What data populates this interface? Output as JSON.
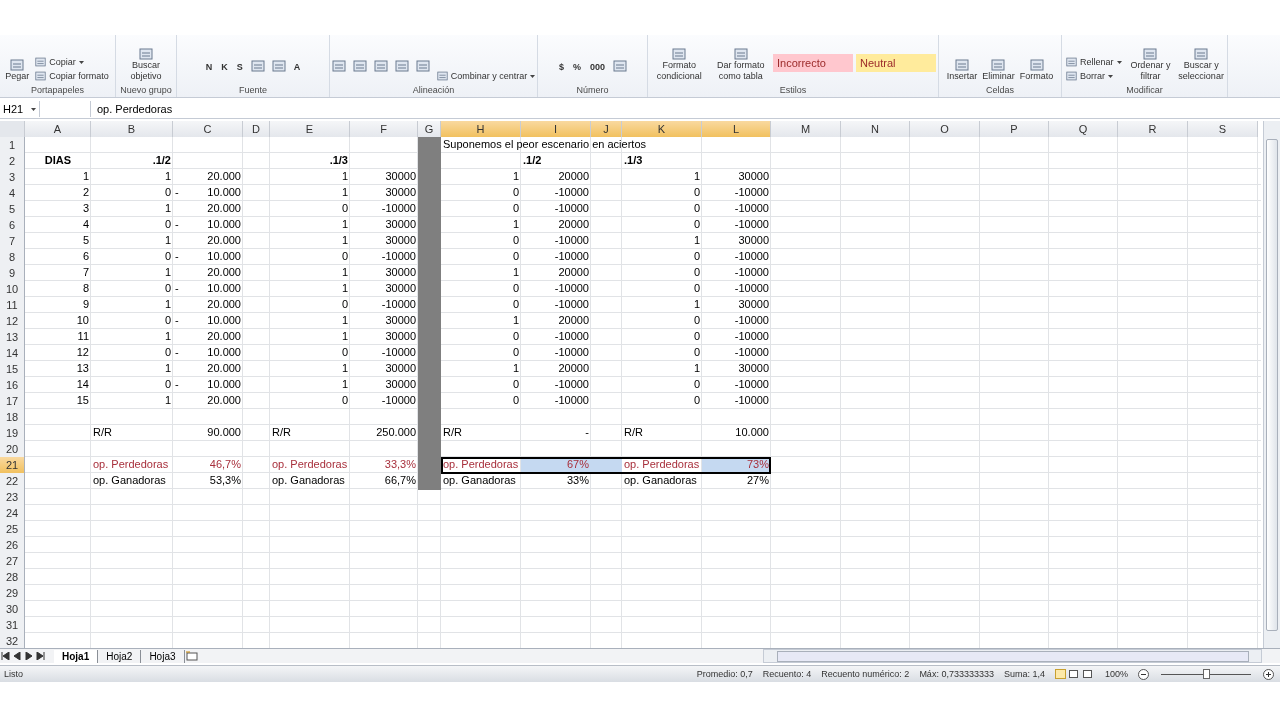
{
  "ribbon": {
    "groups": [
      {
        "label": "Portapapeles",
        "columns": [
          [
            {
              "kind": "big",
              "label": "Pegar"
            }
          ],
          [
            {
              "kind": "small",
              "label": "Copiar",
              "caret": true
            },
            {
              "kind": "small",
              "label": "Copiar formato",
              "caret": false
            }
          ]
        ]
      },
      {
        "label": "Nuevo grupo",
        "columns": [
          [
            {
              "kind": "big",
              "label": "Buscar objetivo"
            }
          ]
        ]
      },
      {
        "label": "Fuente",
        "columns": [
          [
            {
              "kind": "glyph",
              "label": "N"
            }
          ],
          [
            {
              "kind": "glyph",
              "label": "K"
            }
          ],
          [
            {
              "kind": "glyph",
              "label": "S"
            }
          ],
          [
            {
              "kind": "icon"
            }
          ],
          [
            {
              "kind": "icon"
            }
          ],
          [
            {
              "kind": "glyph",
              "label": "A"
            }
          ]
        ]
      },
      {
        "label": "Alineación",
        "columns": [
          [
            {
              "kind": "icon"
            }
          ],
          [
            {
              "kind": "icon"
            }
          ],
          [
            {
              "kind": "icon"
            }
          ],
          [
            {
              "kind": "icon"
            }
          ],
          [
            {
              "kind": "icon"
            }
          ],
          [
            {
              "kind": "small",
              "label": "Combinar y centrar",
              "caret": true
            }
          ]
        ]
      },
      {
        "label": "Número",
        "columns": [
          [
            {
              "kind": "glyph",
              "label": "$"
            }
          ],
          [
            {
              "kind": "glyph",
              "label": "%"
            }
          ],
          [
            {
              "kind": "glyph",
              "label": "000"
            }
          ],
          [
            {
              "kind": "icon"
            }
          ]
        ]
      },
      {
        "label": "Estilos",
        "columns": [
          [
            {
              "kind": "big",
              "label": "Formato condicional"
            }
          ],
          [
            {
              "kind": "big",
              "label": "Dar formato como tabla"
            }
          ],
          [
            {
              "kind": "style",
              "label": "Incorrecto",
              "color": "#ffc7ce"
            }
          ],
          [
            {
              "kind": "style",
              "label": "Neutral",
              "color": "#ffeb9c"
            }
          ]
        ]
      },
      {
        "label": "Celdas",
        "columns": [
          [
            {
              "kind": "big",
              "label": "Insertar"
            }
          ],
          [
            {
              "kind": "big",
              "label": "Eliminar"
            }
          ],
          [
            {
              "kind": "big",
              "label": "Formato"
            }
          ]
        ]
      },
      {
        "label": "Modificar",
        "columns": [
          [
            {
              "kind": "small",
              "label": "Rellenar",
              "caret": true
            },
            {
              "kind": "small",
              "label": "Borrar",
              "caret": true
            }
          ],
          [
            {
              "kind": "big",
              "label": "Ordenar y filtrar"
            }
          ],
          [
            {
              "kind": "big",
              "label": "Buscar y seleccionar"
            }
          ]
        ]
      }
    ]
  },
  "formula_bar": {
    "name_box": "H21",
    "formula": "op. Perdedoras"
  },
  "columns": [
    {
      "label": "A",
      "selected": false
    },
    {
      "label": "B",
      "selected": false
    },
    {
      "label": "C",
      "selected": false
    },
    {
      "label": "D",
      "selected": false
    },
    {
      "label": "E",
      "selected": false
    },
    {
      "label": "F",
      "selected": false
    },
    {
      "label": "G",
      "selected": false
    },
    {
      "label": "H",
      "selected": true
    },
    {
      "label": "I",
      "selected": true
    },
    {
      "label": "J",
      "selected": true
    },
    {
      "label": "K",
      "selected": true
    },
    {
      "label": "L",
      "selected": true
    },
    {
      "label": "M",
      "selected": false
    },
    {
      "label": "N",
      "selected": false
    },
    {
      "label": "O",
      "selected": false
    },
    {
      "label": "P",
      "selected": false
    },
    {
      "label": "Q",
      "selected": false
    },
    {
      "label": "R",
      "selected": false
    },
    {
      "label": "S",
      "selected": false
    }
  ],
  "rows": [
    {
      "n": "1",
      "kind": "title",
      "selected": false,
      "cells": {
        "H": "Suponemos el peor escenario en aciertos"
      }
    },
    {
      "n": "2",
      "kind": "header",
      "selected": false,
      "cells": {
        "A": "DIAS",
        "B": ".1/2",
        "E": ".1/3",
        "I": ".1/2",
        "K": ".1/3"
      }
    },
    {
      "n": "3",
      "kind": "data",
      "selected": false,
      "cells": {
        "A": "1",
        "B": "1",
        "C": "20.000",
        "E": "1",
        "F": "30000",
        "H": "1",
        "I": "20000",
        "K": "1",
        "L": "30000"
      }
    },
    {
      "n": "4",
      "kind": "data",
      "selected": false,
      "cells": {
        "A": "2",
        "B": "0",
        "C": {
          "sign": "-",
          "text": "10.000"
        },
        "E": "1",
        "F": "30000",
        "H": "0",
        "I": "-10000",
        "K": "0",
        "L": "-10000"
      }
    },
    {
      "n": "5",
      "kind": "data",
      "selected": false,
      "cells": {
        "A": "3",
        "B": "1",
        "C": "20.000",
        "E": "0",
        "F": "-10000",
        "H": "0",
        "I": "-10000",
        "K": "0",
        "L": "-10000"
      }
    },
    {
      "n": "6",
      "kind": "data",
      "selected": false,
      "cells": {
        "A": "4",
        "B": "0",
        "C": {
          "sign": "-",
          "text": "10.000"
        },
        "E": "1",
        "F": "30000",
        "H": "1",
        "I": "20000",
        "K": "0",
        "L": "-10000"
      }
    },
    {
      "n": "7",
      "kind": "data",
      "selected": false,
      "cells": {
        "A": "5",
        "B": "1",
        "C": "20.000",
        "E": "1",
        "F": "30000",
        "H": "0",
        "I": "-10000",
        "K": "1",
        "L": "30000"
      }
    },
    {
      "n": "8",
      "kind": "data",
      "selected": false,
      "cells": {
        "A": "6",
        "B": "0",
        "C": {
          "sign": "-",
          "text": "10.000"
        },
        "E": "0",
        "F": "-10000",
        "H": "0",
        "I": "-10000",
        "K": "0",
        "L": "-10000"
      }
    },
    {
      "n": "9",
      "kind": "data",
      "selected": false,
      "cells": {
        "A": "7",
        "B": "1",
        "C": "20.000",
        "E": "1",
        "F": "30000",
        "H": "1",
        "I": "20000",
        "K": "0",
        "L": "-10000"
      }
    },
    {
      "n": "10",
      "kind": "data",
      "selected": false,
      "cells": {
        "A": "8",
        "B": "0",
        "C": {
          "sign": "-",
          "text": "10.000"
        },
        "E": "1",
        "F": "30000",
        "H": "0",
        "I": "-10000",
        "K": "0",
        "L": "-10000"
      }
    },
    {
      "n": "11",
      "kind": "data",
      "selected": false,
      "cells": {
        "A": "9",
        "B": "1",
        "C": "20.000",
        "E": "0",
        "F": "-10000",
        "H": "0",
        "I": "-10000",
        "K": "1",
        "L": "30000"
      }
    },
    {
      "n": "12",
      "kind": "data",
      "selected": false,
      "cells": {
        "A": "10",
        "B": "0",
        "C": {
          "sign": "-",
          "text": "10.000"
        },
        "E": "1",
        "F": "30000",
        "H": "1",
        "I": "20000",
        "K": "0",
        "L": "-10000"
      }
    },
    {
      "n": "13",
      "kind": "data",
      "selected": false,
      "cells": {
        "A": "11",
        "B": "1",
        "C": "20.000",
        "E": "1",
        "F": "30000",
        "H": "0",
        "I": "-10000",
        "K": "0",
        "L": "-10000"
      }
    },
    {
      "n": "14",
      "kind": "data",
      "selected": false,
      "cells": {
        "A": "12",
        "B": "0",
        "C": {
          "sign": "-",
          "text": "10.000"
        },
        "E": "0",
        "F": "-10000",
        "H": "0",
        "I": "-10000",
        "K": "0",
        "L": "-10000"
      }
    },
    {
      "n": "15",
      "kind": "data",
      "selected": false,
      "cells": {
        "A": "13",
        "B": "1",
        "C": "20.000",
        "E": "1",
        "F": "30000",
        "H": "1",
        "I": "20000",
        "K": "1",
        "L": "30000"
      }
    },
    {
      "n": "16",
      "kind": "data",
      "selected": false,
      "cells": {
        "A": "14",
        "B": "0",
        "C": {
          "sign": "-",
          "text": "10.000"
        },
        "E": "1",
        "F": "30000",
        "H": "0",
        "I": "-10000",
        "K": "0",
        "L": "-10000"
      }
    },
    {
      "n": "17",
      "kind": "data",
      "selected": false,
      "cells": {
        "A": "15",
        "B": "1",
        "C": "20.000",
        "E": "0",
        "F": "-10000",
        "H": "0",
        "I": "-10000",
        "K": "0",
        "L": "-10000"
      }
    },
    {
      "n": "18",
      "kind": "label",
      "selected": false,
      "cells": {}
    },
    {
      "n": "19",
      "kind": "label",
      "selected": false,
      "cells": {
        "B": "R/R",
        "C": "90.000",
        "E": "R/R",
        "F": "250.000",
        "H": "R/R",
        "I": "-",
        "K": "R/R",
        "L": "10.000"
      }
    },
    {
      "n": "20",
      "kind": "label",
      "selected": false,
      "cells": {}
    },
    {
      "n": "21",
      "kind": "label",
      "selected": true,
      "color": "#a8303c",
      "cells": {
        "B": "op. Perdedoras",
        "C": "46,7%",
        "E": "op. Perdedoras",
        "F": "33,3%",
        "H": {
          "text": "op. Perdedoras",
          "highlighted": false
        },
        "I": {
          "text": "67%",
          "highlighted": true
        },
        "J": {
          "highlighted": true
        },
        "K": {
          "text": "op. Perdedoras",
          "highlighted": false
        },
        "L": {
          "text": "73%",
          "highlighted": true
        }
      }
    },
    {
      "n": "22",
      "kind": "label",
      "selected": false,
      "cells": {
        "B": "op. Ganadoras",
        "C": "53,3%",
        "E": "op. Ganadoras",
        "F": "66,7%",
        "H": "op. Ganadoras",
        "I": "33%",
        "K": "op. Ganadoras",
        "L": "27%"
      }
    },
    {
      "n": "23",
      "kind": "blank",
      "selected": false,
      "cells": {}
    },
    {
      "n": "24",
      "kind": "blank",
      "selected": false,
      "cells": {}
    },
    {
      "n": "25",
      "kind": "blank",
      "selected": false,
      "cells": {}
    },
    {
      "n": "26",
      "kind": "blank",
      "selected": false,
      "cells": {}
    },
    {
      "n": "27",
      "kind": "blank",
      "selected": false,
      "cells": {}
    },
    {
      "n": "28",
      "kind": "blank",
      "selected": false,
      "cells": {}
    },
    {
      "n": "29",
      "kind": "blank",
      "selected": false,
      "cells": {}
    },
    {
      "n": "30",
      "kind": "blank",
      "selected": false,
      "cells": {}
    },
    {
      "n": "31",
      "kind": "blank",
      "selected": false,
      "cells": {}
    },
    {
      "n": "32",
      "kind": "blank",
      "selected": false,
      "cells": {}
    }
  ],
  "sheet_tabs": [
    {
      "label": "Hoja1",
      "selected": true
    },
    {
      "label": "Hoja2",
      "selected": false
    },
    {
      "label": "Hoja3",
      "selected": false
    }
  ],
  "status_bar": {
    "mode": "Listo",
    "stats": [
      "Promedio: 0,7",
      "Recuento: 4",
      "Recuento numérico: 2",
      "Máx: 0,733333333",
      "Suma: 1,4"
    ],
    "zoom": "100%",
    "zoom_slider": {
      "level": 0.5
    }
  }
}
